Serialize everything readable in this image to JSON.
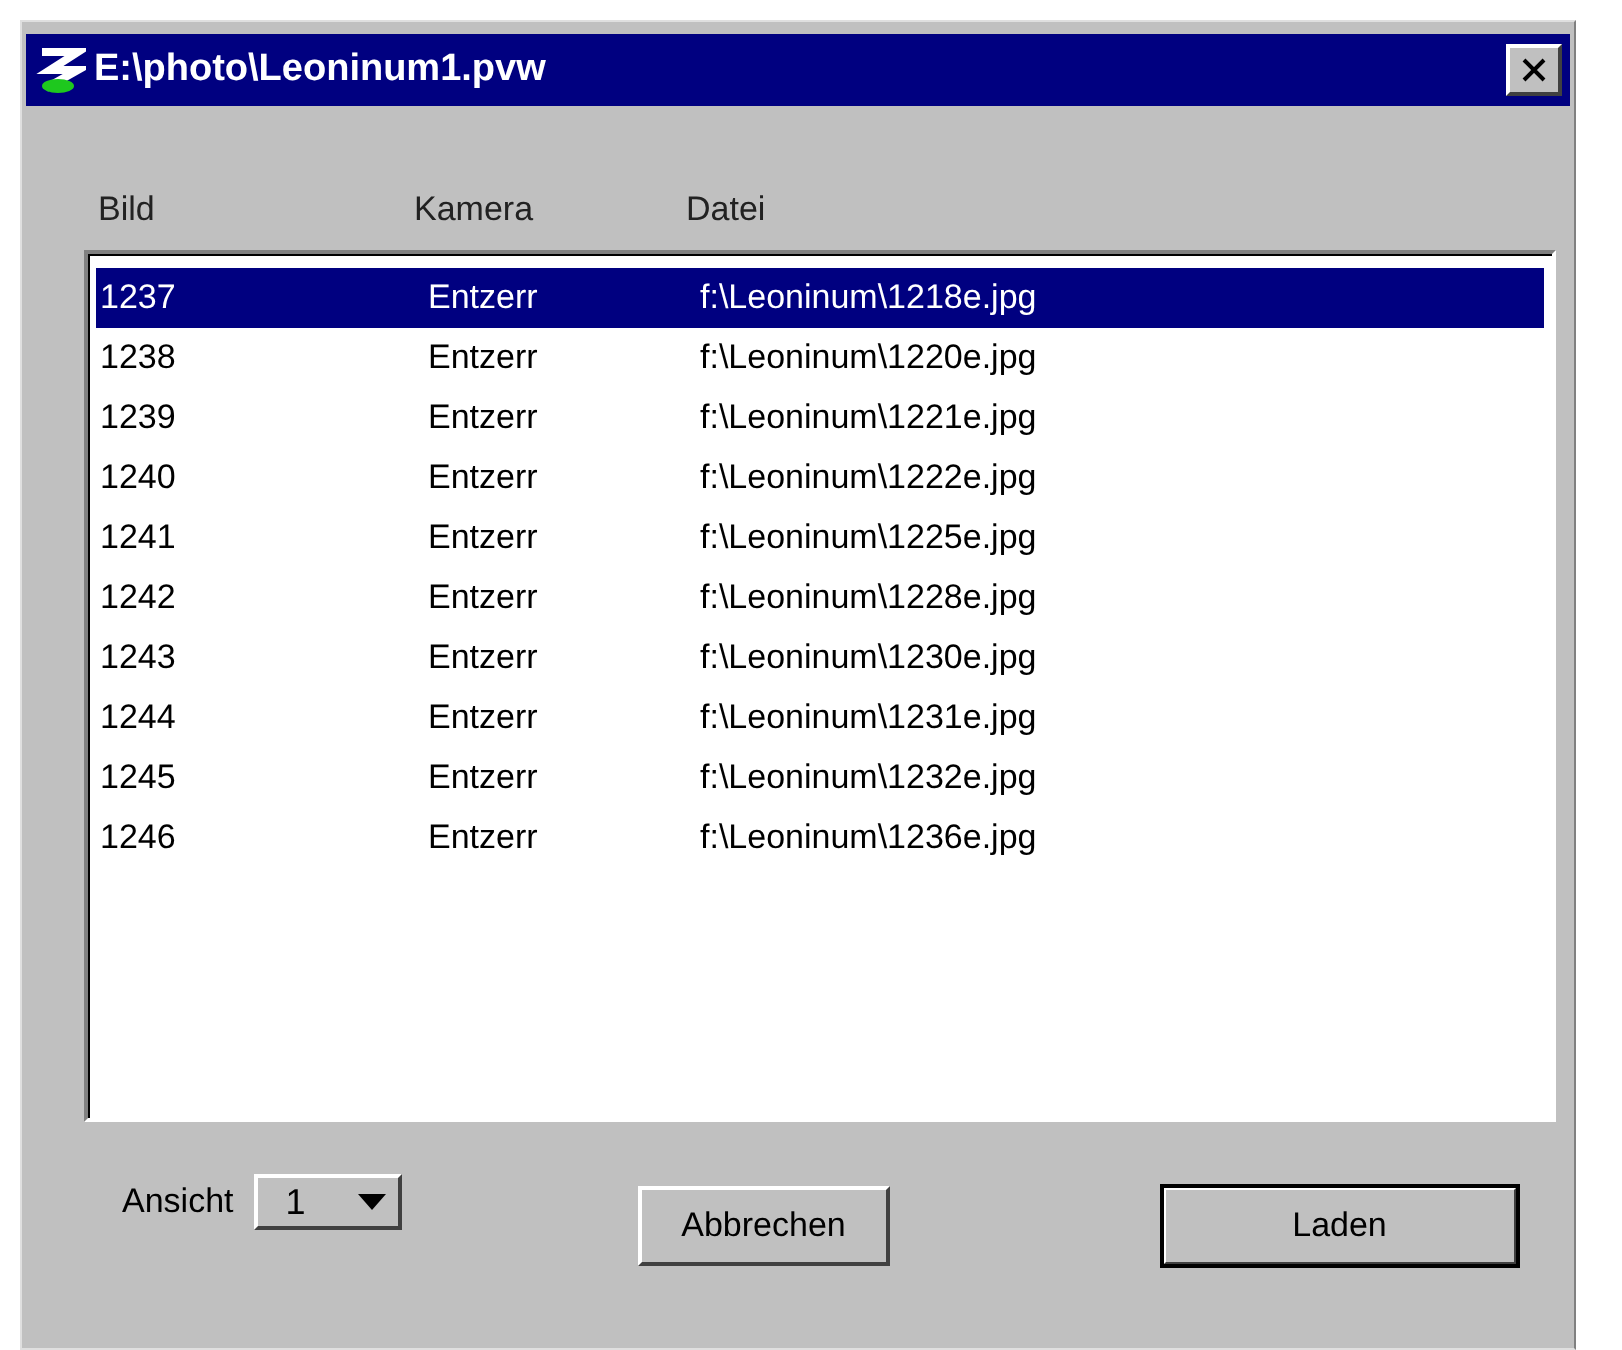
{
  "window": {
    "title": "E:\\photo\\Leoninum1.pvw"
  },
  "table": {
    "columns": [
      "Bild",
      "Kamera",
      "Datei"
    ],
    "rows": [
      {
        "cells": [
          "1237",
          "Entzerr",
          "f:\\Leoninum\\1218e.jpg"
        ],
        "selected": true
      },
      {
        "cells": [
          "1238",
          "Entzerr",
          "f:\\Leoninum\\1220e.jpg"
        ],
        "selected": false
      },
      {
        "cells": [
          "1239",
          "Entzerr",
          "f:\\Leoninum\\1221e.jpg"
        ],
        "selected": false
      },
      {
        "cells": [
          "1240",
          "Entzerr",
          "f:\\Leoninum\\1222e.jpg"
        ],
        "selected": false
      },
      {
        "cells": [
          "1241",
          "Entzerr",
          "f:\\Leoninum\\1225e.jpg"
        ],
        "selected": false
      },
      {
        "cells": [
          "1242",
          "Entzerr",
          "f:\\Leoninum\\1228e.jpg"
        ],
        "selected": false
      },
      {
        "cells": [
          "1243",
          "Entzerr",
          "f:\\Leoninum\\1230e.jpg"
        ],
        "selected": false
      },
      {
        "cells": [
          "1244",
          "Entzerr",
          "f:\\Leoninum\\1231e.jpg"
        ],
        "selected": false
      },
      {
        "cells": [
          "1245",
          "Entzerr",
          "f:\\Leoninum\\1232e.jpg"
        ],
        "selected": false
      },
      {
        "cells": [
          "1246",
          "Entzerr",
          "f:\\Leoninum\\1236e.jpg"
        ],
        "selected": false
      }
    ]
  },
  "view": {
    "label": "Ansicht",
    "value": "1"
  },
  "buttons": [
    {
      "label": "Abbrechen",
      "default": false
    },
    {
      "label": "Laden",
      "default": true
    }
  ]
}
